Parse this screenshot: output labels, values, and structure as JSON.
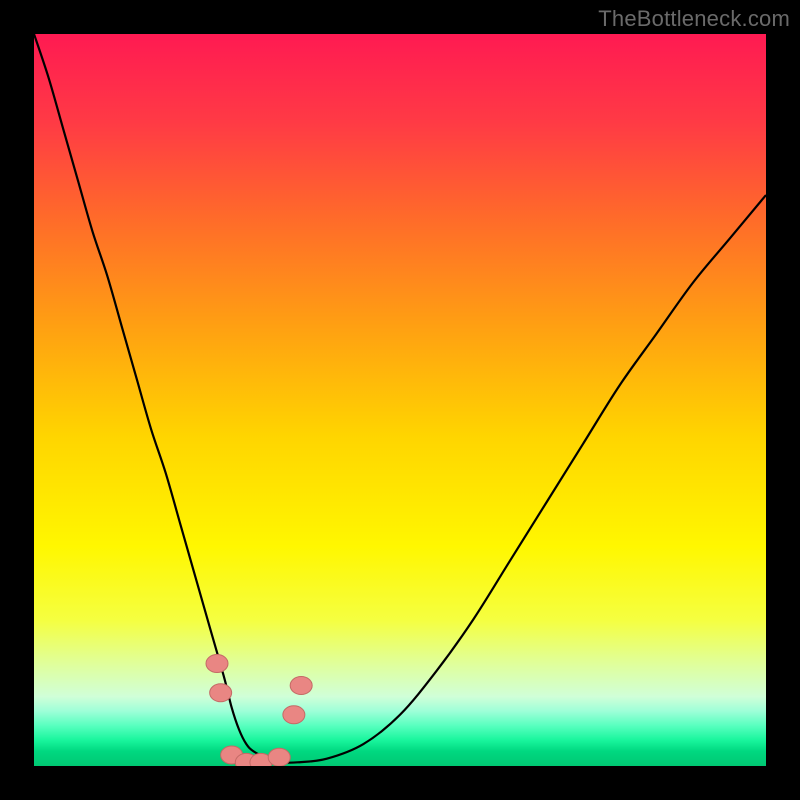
{
  "credit": "TheBottleneck.com",
  "chart_data": {
    "type": "line",
    "title": "",
    "xlabel": "",
    "ylabel": "",
    "xlim": [
      0,
      100
    ],
    "ylim": [
      0,
      100
    ],
    "grid": false,
    "legend": false,
    "series": [
      {
        "name": "curve",
        "x": [
          0,
          2,
          4,
          6,
          8,
          10,
          12,
          14,
          16,
          18,
          20,
          22,
          24,
          26,
          27,
          28,
          29,
          30,
          32,
          34,
          36,
          40,
          45,
          50,
          55,
          60,
          65,
          70,
          75,
          80,
          85,
          90,
          95,
          100
        ],
        "y": [
          100,
          94,
          87,
          80,
          73,
          67,
          60,
          53,
          46,
          40,
          33,
          26,
          19,
          12,
          8,
          5,
          3,
          2,
          1,
          0.5,
          0.5,
          1,
          3,
          7,
          13,
          20,
          28,
          36,
          44,
          52,
          59,
          66,
          72,
          78
        ]
      },
      {
        "name": "markers",
        "x": [
          25.0,
          25.5,
          27.0,
          29.0,
          31.0,
          33.5,
          35.5,
          36.5
        ],
        "y": [
          14,
          10,
          1.5,
          0.5,
          0.5,
          1.2,
          7,
          11
        ]
      }
    ],
    "gradient_bands": [
      {
        "stop": 0.0,
        "color": "#ff1a52"
      },
      {
        "stop": 0.12,
        "color": "#ff3a45"
      },
      {
        "stop": 0.25,
        "color": "#ff6a2a"
      },
      {
        "stop": 0.4,
        "color": "#ffa012"
      },
      {
        "stop": 0.55,
        "color": "#ffd500"
      },
      {
        "stop": 0.7,
        "color": "#fff700"
      },
      {
        "stop": 0.8,
        "color": "#f5ff40"
      },
      {
        "stop": 0.86,
        "color": "#e0ff9a"
      },
      {
        "stop": 0.905,
        "color": "#d0ffd8"
      },
      {
        "stop": 0.925,
        "color": "#9effd8"
      },
      {
        "stop": 0.945,
        "color": "#58ffbf"
      },
      {
        "stop": 0.965,
        "color": "#18f59c"
      },
      {
        "stop": 0.98,
        "color": "#00d880"
      },
      {
        "stop": 1.0,
        "color": "#00c873"
      }
    ],
    "colors": {
      "curve_stroke": "#000000",
      "marker_fill": "#e98683",
      "marker_stroke": "#c46a66"
    }
  }
}
